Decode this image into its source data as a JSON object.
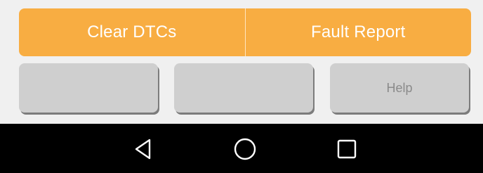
{
  "actions": {
    "primary": [
      {
        "label": "Clear DTCs"
      },
      {
        "label": "Fault Report"
      }
    ],
    "secondary": [
      {
        "label": ""
      },
      {
        "label": ""
      },
      {
        "label": "Help"
      }
    ]
  },
  "navbar": {
    "back_icon": "back-triangle-icon",
    "home_icon": "home-circle-icon",
    "recents_icon": "recents-square-icon"
  },
  "colors": {
    "primary_orange": "#f8ad42",
    "secondary_gray": "#cfcfcf",
    "navbar_black": "#000000",
    "background": "#f0f0f0"
  }
}
